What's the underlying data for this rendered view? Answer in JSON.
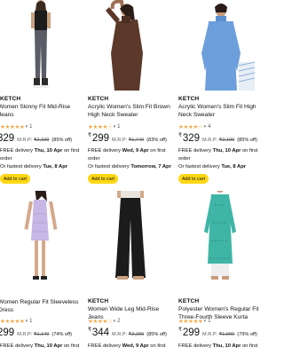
{
  "products": [
    {
      "brand": "KETCH",
      "title_lines": [
        "Women Skinny Fit Mid-Rise",
        "Jeans"
      ],
      "stars": "★★★★★",
      "rating_count": "1",
      "currency": "₹",
      "price": "329",
      "mrp_label": "M.R.P:",
      "mrp": "₹2,199",
      "discount": "(85% off)",
      "delivery_line1_prefix": "FREE delivery ",
      "delivery_line1_bold": "Thu, 10 Apr",
      "delivery_line1_suffix": " on first",
      "delivery_line2": "order",
      "delivery_line3_prefix": "Or fastest delivery ",
      "delivery_line3_bold": "Tue, 8 Apr",
      "cart_label": "Add to cart"
    },
    {
      "brand": "KETCH",
      "title_lines": [
        "Acrylic Women's Slim Fit Brown",
        "High Neck Sweater"
      ],
      "stars": "★★★★☆",
      "rating_count": "1",
      "currency": "₹",
      "price": "299",
      "mrp_label": "M.R.P:",
      "mrp": "₹1,749",
      "discount": "(83% off)",
      "delivery_line1_prefix": "FREE delivery ",
      "delivery_line1_bold": "Wed, 9 Apr",
      "delivery_line1_suffix": " on first",
      "delivery_line2": "order",
      "delivery_line3_prefix": "Or fastest delivery ",
      "delivery_line3_bold": "Tomorrow, 7 Apr",
      "cart_label": "Add to cart"
    },
    {
      "brand": "KETCH",
      "title_lines": [
        "Acrylic Women's Slim Fit High",
        "Neck Sweater"
      ],
      "stars": "★★★★☆",
      "rating_count": "4",
      "currency": "₹",
      "price": "329",
      "mrp_label": "M.R.P:",
      "mrp": "₹2,199",
      "discount": "(85% off)",
      "delivery_line1_prefix": "FREE delivery ",
      "delivery_line1_bold": "Thu, 10 Apr",
      "delivery_line1_suffix": " on first",
      "delivery_line2": "order",
      "delivery_line3_prefix": "Or fastest delivery ",
      "delivery_line3_bold": "Tue, 8 Apr",
      "cart_label": "Add to cart"
    },
    {
      "brand": "",
      "title_lines": [
        "Women Regular Fit Sleeveless",
        "Dress"
      ],
      "stars": "★★★★★",
      "rating_count": "1",
      "currency": "₹",
      "price": "299",
      "mrp_label": "M.R.P:",
      "mrp": "₹1,149",
      "discount": "(74% off)",
      "delivery_line1_prefix": "FREE delivery ",
      "delivery_line1_bold": "Thu, 10 Apr",
      "delivery_line1_suffix": " on first",
      "delivery_line2": "",
      "delivery_line3_prefix": "",
      "delivery_line3_bold": "",
      "cart_label": ""
    },
    {
      "brand": "KETCH",
      "title_lines": [
        "Women Wide Leg Mid-Rise",
        "Jeans"
      ],
      "stars": "★★★★☆",
      "rating_count": "2",
      "currency": "₹",
      "price": "344",
      "mrp_label": "M.R.P:",
      "mrp": "₹2,299",
      "discount": "(85% off)",
      "delivery_line1_prefix": "FREE delivery ",
      "delivery_line1_bold": "Wed, 9 Apr",
      "delivery_line1_suffix": " on first",
      "delivery_line2": "",
      "delivery_line3_prefix": "",
      "delivery_line3_bold": "",
      "cart_label": ""
    },
    {
      "brand": "KETCH",
      "title_lines": [
        "Polyester Women's Regular Fit",
        "Three-Fourth Sleeve Kurta"
      ],
      "stars": "★★★★★",
      "rating_count": "1",
      "currency": "₹",
      "price": "299",
      "mrp_label": "M.R.P:",
      "mrp": "₹1,999",
      "discount": "(79% off)",
      "delivery_line1_prefix": "FREE delivery ",
      "delivery_line1_bold": "Thu, 10 Apr",
      "delivery_line1_suffix": " on first",
      "delivery_line2": "",
      "delivery_line3_prefix": "",
      "delivery_line3_bold": "",
      "cart_label": ""
    }
  ],
  "colors": {
    "star": "#f3a847",
    "cart_button": "#ffd814",
    "text": "#0f1111",
    "muted": "#565959"
  }
}
